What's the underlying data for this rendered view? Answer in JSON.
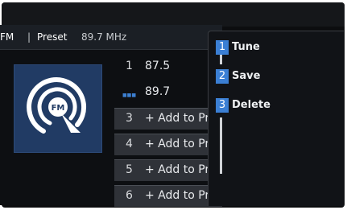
{
  "header": {
    "band": "FM",
    "separator": "|",
    "mode": "Preset",
    "frequency": "89.7 MHz"
  },
  "station_logo": {
    "icon": "fm-radio-signal-icon",
    "label": "FM"
  },
  "presets": [
    {
      "number": "1",
      "text": "87.5"
    },
    {
      "number": "",
      "text": "89.7",
      "indicator": "■■■"
    },
    {
      "number": "3",
      "text": "+ Add to Pres"
    },
    {
      "number": "4",
      "text": "+ Add to Pres"
    },
    {
      "number": "5",
      "text": "+ Add to Pres"
    },
    {
      "number": "6",
      "text": "+ Add to Pres"
    }
  ],
  "menu": {
    "items": [
      {
        "badge": "1",
        "label": "Tune"
      },
      {
        "badge": "2",
        "label": "Save"
      },
      {
        "badge": "3",
        "label": "Delete"
      }
    ]
  },
  "colors": {
    "accent": "#3b7fd4",
    "logo_bg": "#213b64",
    "slot_bg": "#2f3238"
  }
}
